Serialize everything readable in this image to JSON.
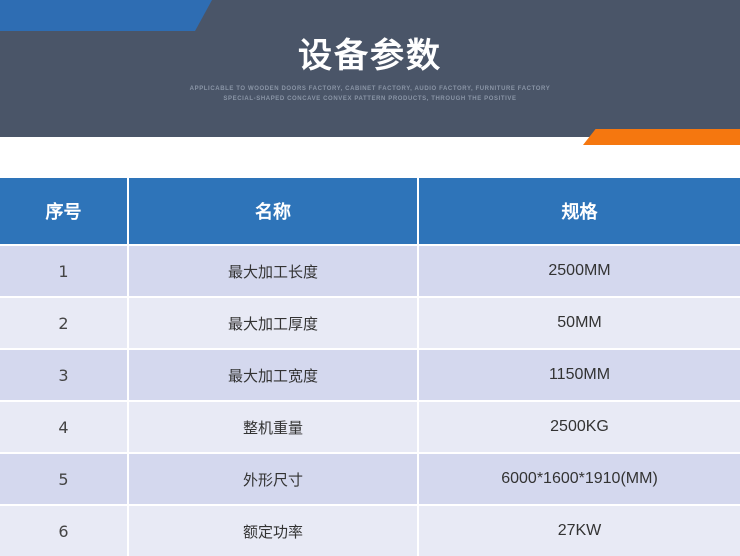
{
  "header": {
    "title": "设备参数",
    "subtitle_line1": "Applicable to wooden doors factory, cabinet factory, audio factory, furniture factory",
    "subtitle_line2": "special-shaped concave convex pattern products, through the positive",
    "colors": {
      "banner": "#4a5568",
      "blue_accent": "#2e6db3",
      "orange_accent": "#f5770f"
    }
  },
  "table": {
    "headers": [
      "序号",
      "名称",
      "规格"
    ],
    "rows": [
      {
        "no": "1",
        "name": "最大加工长度",
        "spec": "2500MM"
      },
      {
        "no": "2",
        "name": "最大加工厚度",
        "spec": "50MM"
      },
      {
        "no": "3",
        "name": "最大加工宽度",
        "spec": "1150MM"
      },
      {
        "no": "4",
        "name": "整机重量",
        "spec": "2500KG"
      },
      {
        "no": "5",
        "name": "外形尺寸",
        "spec": "6000*1600*1910(MM)"
      },
      {
        "no": "6",
        "name": "额定功率",
        "spec": "27KW"
      }
    ],
    "colors": {
      "header": "#2e74b9",
      "row_odd": "#d4d8ee",
      "row_even": "#e8eaf5"
    }
  }
}
